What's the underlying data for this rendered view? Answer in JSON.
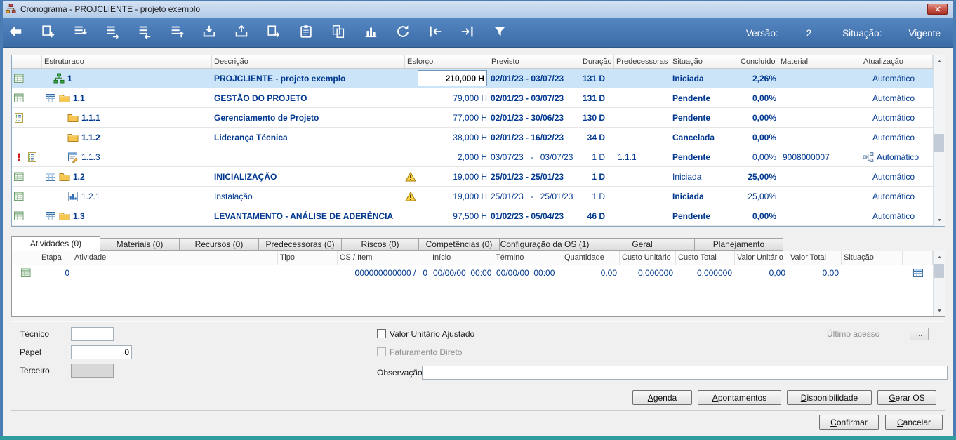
{
  "window": {
    "title": "Cronograma - PROJCLIENTE - projeto exemplo"
  },
  "toolbar": {
    "icons": [
      {
        "name": "back"
      },
      {
        "name": "add-task"
      },
      {
        "name": "insert-child"
      },
      {
        "name": "indent"
      },
      {
        "name": "outdent"
      },
      {
        "name": "move-task"
      },
      {
        "name": "import"
      },
      {
        "name": "export"
      },
      {
        "name": "send-sheet"
      },
      {
        "name": "paste"
      },
      {
        "name": "copy"
      },
      {
        "name": "chart"
      },
      {
        "name": "refresh"
      },
      {
        "name": "nav-start"
      },
      {
        "name": "nav-end"
      },
      {
        "name": "filter"
      }
    ],
    "versao_label": "Versão:",
    "versao_value": "2",
    "situacao_label": "Situação:",
    "situacao_value": "Vigente"
  },
  "grid": {
    "columns": [
      "",
      "Estruturado",
      "Descrição",
      "Esforço",
      "Previsto",
      "Duração",
      "Predecessoras",
      "Situação",
      "Concluído",
      "Material",
      "Atualização"
    ],
    "rows": [
      {
        "row_icons": [
          "sheet"
        ],
        "level": 0,
        "node_icons": [
          "tree"
        ],
        "estruturado": "1",
        "descricao": "PROJCLIENTE - projeto exemplo",
        "warning": false,
        "esforco": "210,000 H",
        "esforco_edit": true,
        "previsto": "02/01/23 - 03/07/23",
        "duracao": "131 D",
        "predecessoras": "",
        "situacao": "Iniciada",
        "concluido": "2,26%",
        "material": "",
        "workflow_icon": false,
        "atualizacao": "Automático",
        "selected": true,
        "b_estr": true,
        "b_desc": true,
        "b_prev": true,
        "b_dur": true,
        "b_sit": true,
        "b_conc": true
      },
      {
        "row_icons": [
          "sheet"
        ],
        "level": 1,
        "node_icons": [
          "table",
          "folder"
        ],
        "estruturado": "1.1",
        "descricao": "GESTÃO DO PROJETO",
        "warning": false,
        "esforco": "79,000 H",
        "esforco_edit": false,
        "previsto": "02/01/23 - 03/07/23",
        "duracao": "131 D",
        "predecessoras": "",
        "situacao": "Pendente",
        "concluido": "0,00%",
        "material": "",
        "workflow_icon": false,
        "atualizacao": "Automático",
        "selected": false,
        "b_estr": true,
        "b_desc": true,
        "b_prev": true,
        "b_dur": true,
        "b_sit": true,
        "b_conc": true
      },
      {
        "row_icons": [
          "list"
        ],
        "level": 2,
        "node_icons": [
          "folder"
        ],
        "estruturado": "1.1.1",
        "descricao": "Gerenciamento de Projeto",
        "warning": false,
        "esforco": "77,000 H",
        "esforco_edit": false,
        "previsto": "02/01/23 - 30/06/23",
        "duracao": "130 D",
        "predecessoras": "",
        "situacao": "Pendente",
        "concluido": "0,00%",
        "material": "",
        "workflow_icon": false,
        "atualizacao": "Automático",
        "selected": false,
        "b_estr": true,
        "b_desc": true,
        "b_prev": true,
        "b_dur": true,
        "b_sit": true,
        "b_conc": true
      },
      {
        "row_icons": [],
        "level": 2,
        "node_icons": [
          "folder"
        ],
        "estruturado": "1.1.2",
        "descricao": "Liderança Técnica",
        "warning": false,
        "esforco": "38,000 H",
        "esforco_edit": false,
        "previsto": "02/01/23 - 16/02/23",
        "duracao": "34 D",
        "predecessoras": "",
        "situacao": "Cancelada",
        "concluido": "0,00%",
        "material": "",
        "workflow_icon": false,
        "atualizacao": "Automático",
        "selected": false,
        "b_estr": true,
        "b_desc": true,
        "b_prev": true,
        "b_dur": true,
        "b_sit": true,
        "b_conc": true
      },
      {
        "row_icons": [
          "alert",
          "list"
        ],
        "level": 2,
        "node_icons": [
          "task"
        ],
        "estruturado": "1.1.3",
        "descricao": "",
        "warning": false,
        "esforco": "2,000 H",
        "esforco_edit": false,
        "previsto": "03/07/23   -   03/07/23",
        "duracao": "1 D",
        "predecessoras": "1.1.1",
        "situacao": "Pendente",
        "concluido": "0,00%",
        "material": "9008000007",
        "workflow_icon": true,
        "atualizacao": "Automático",
        "selected": false,
        "b_estr": false,
        "b_desc": false,
        "b_prev": false,
        "b_dur": false,
        "b_sit": true,
        "b_conc": false
      },
      {
        "row_icons": [
          "sheet"
        ],
        "level": 1,
        "node_icons": [
          "table",
          "folder"
        ],
        "estruturado": "1.2",
        "descricao": "INICIALIZAÇÃO",
        "warning": true,
        "esforco": "19,000 H",
        "esforco_edit": false,
        "previsto": "25/01/23 - 25/01/23",
        "duracao": "1 D",
        "predecessoras": "",
        "situacao": "Iniciada",
        "concluido": "25,00%",
        "material": "",
        "workflow_icon": false,
        "atualizacao": "Automático",
        "selected": false,
        "b_estr": true,
        "b_desc": true,
        "b_prev": true,
        "b_dur": true,
        "b_sit": false,
        "b_conc": true
      },
      {
        "row_icons": [
          "sheet"
        ],
        "level": 2,
        "node_icons": [
          "chartbox"
        ],
        "estruturado": "1.2.1",
        "descricao": "Instalação",
        "warning": true,
        "esforco": "19,000 H",
        "esforco_edit": false,
        "previsto": "25/01/23   -   25/01/23",
        "duracao": "1 D",
        "predecessoras": "",
        "situacao": "Iniciada",
        "concluido": "25,00%",
        "material": "",
        "workflow_icon": false,
        "atualizacao": "Automático",
        "selected": false,
        "b_estr": false,
        "b_desc": false,
        "b_prev": false,
        "b_dur": false,
        "b_sit": true,
        "b_conc": false
      },
      {
        "row_icons": [
          "sheet"
        ],
        "level": 1,
        "node_icons": [
          "table",
          "folder"
        ],
        "estruturado": "1.3",
        "descricao": "LEVANTAMENTO - ANÁLISE DE ADERÊNCIA",
        "warning": false,
        "esforco": "97,500 H",
        "esforco_edit": false,
        "previsto": "01/02/23 - 05/04/23",
        "duracao": "46 D",
        "predecessoras": "",
        "situacao": "Pendente",
        "concluido": "0,00%",
        "material": "",
        "workflow_icon": false,
        "atualizacao": "Automático",
        "selected": false,
        "b_estr": true,
        "b_desc": true,
        "b_prev": true,
        "b_dur": true,
        "b_sit": true,
        "b_conc": true
      }
    ]
  },
  "tabs": [
    {
      "label": "Atividades (0)",
      "active": true
    },
    {
      "label": "Materiais (0)",
      "active": false
    },
    {
      "label": "Recursos (0)",
      "active": false
    },
    {
      "label": "Predecessoras (0)",
      "active": false
    },
    {
      "label": "Riscos (0)",
      "active": false
    },
    {
      "label": "Competências (0)",
      "active": false
    },
    {
      "label": "Configuração da OS (1)",
      "active": false
    },
    {
      "label": "Geral",
      "active": false
    },
    {
      "label": "Planejamento",
      "active": false
    }
  ],
  "subgrid": {
    "columns": [
      "",
      "Etapa",
      "Atividade",
      "Tipo",
      "OS / Item",
      "Início",
      "Término",
      "Quantidade",
      "Custo Unitário",
      "Custo Total",
      "Valor Unitário",
      "Valor Total",
      "Situação",
      ""
    ],
    "rows": [
      {
        "etapa": "0",
        "atividade": "",
        "tipo": "",
        "os_item": "000000000000 /",
        "os_item_num": "0",
        "inicio": "00/00/00  00:00",
        "termino": "00/00/00  00:00",
        "quantidade": "0,00",
        "custo_unitario": "0,000000",
        "custo_total": "0,000000",
        "valor_unitario": "0,00",
        "valor_total": "0,00",
        "situacao": ""
      }
    ]
  },
  "form": {
    "tecnico_label": "Técnico",
    "tecnico_value": "",
    "papel_label": "Papel",
    "papel_value": "0",
    "terceiro_label": "Terceiro",
    "terceiro_value": "",
    "valor_unitario_ajustado_label": "Valor Unitário Ajustado",
    "valor_unitario_ajustado_checked": false,
    "faturamento_direto_label": "Faturamento Direto",
    "faturamento_direto_checked": false,
    "observacao_label": "Observação",
    "observacao_value": "",
    "ultimo_acesso_label": "Último acesso",
    "ultimo_acesso_button": "..."
  },
  "actions": [
    {
      "name": "agenda",
      "label": "Agenda"
    },
    {
      "name": "apontamentos",
      "label": "Apontamentos"
    },
    {
      "name": "disponibilidade",
      "label": "Disponibilidade"
    },
    {
      "name": "gerar-os",
      "label": "Gerar OS"
    }
  ],
  "footer": [
    {
      "name": "confirmar",
      "label": "Confirmar"
    },
    {
      "name": "cancelar",
      "label": "Cancelar"
    }
  ],
  "colors": {
    "accent_navy": "#00388f",
    "toolbar_blue": "#3c6ca6",
    "selected_row": "#cbe4f8",
    "window_border": "#4c7cb4",
    "bottom_border": "#2f9d9d"
  }
}
